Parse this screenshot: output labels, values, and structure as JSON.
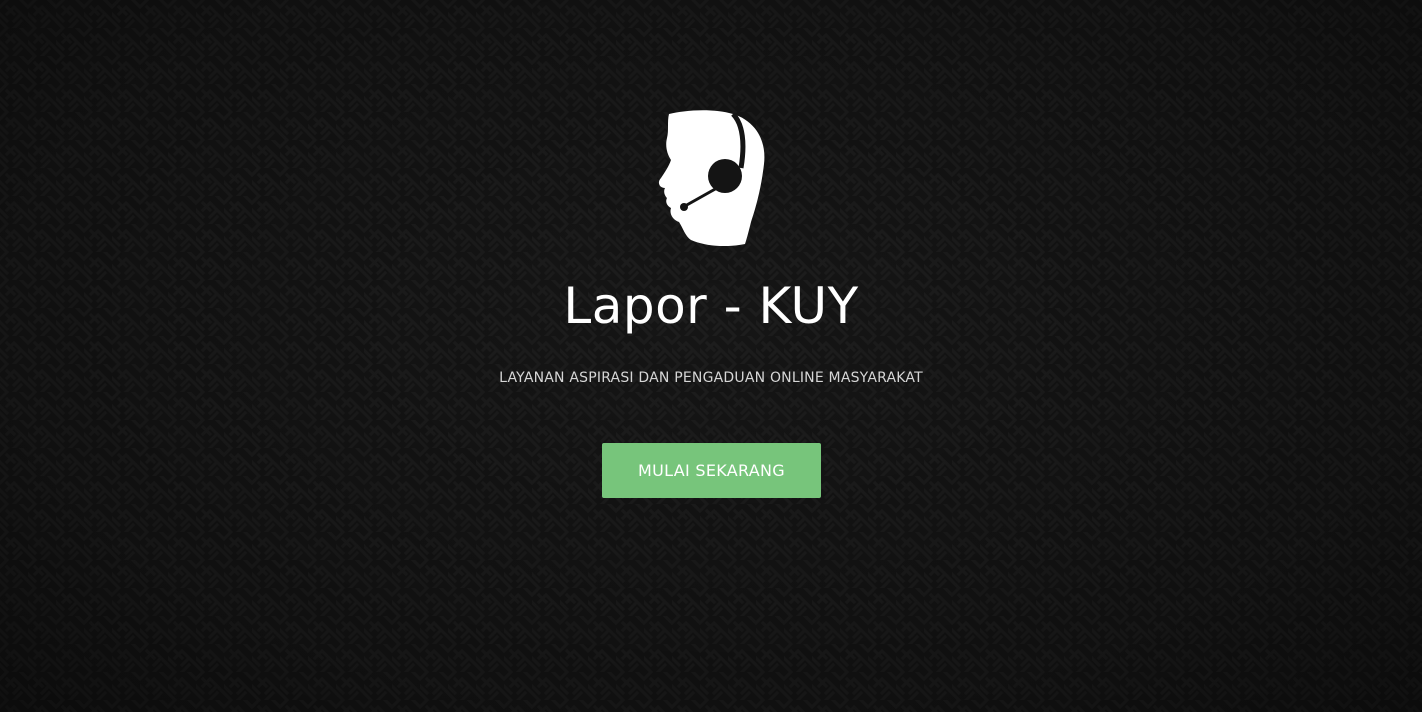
{
  "hero": {
    "logo_icon": "customer-service-headset-icon",
    "title": "Lapor - KUY",
    "subtitle": "LAYANAN ASPIRASI DAN PENGADUAN ONLINE MASYARAKAT",
    "cta_label": "MULAI SEKARANG"
  },
  "colors": {
    "background": "#141414",
    "cta_background": "#77c57b",
    "title": "#ffffff",
    "subtitle": "#d6d6d6"
  }
}
